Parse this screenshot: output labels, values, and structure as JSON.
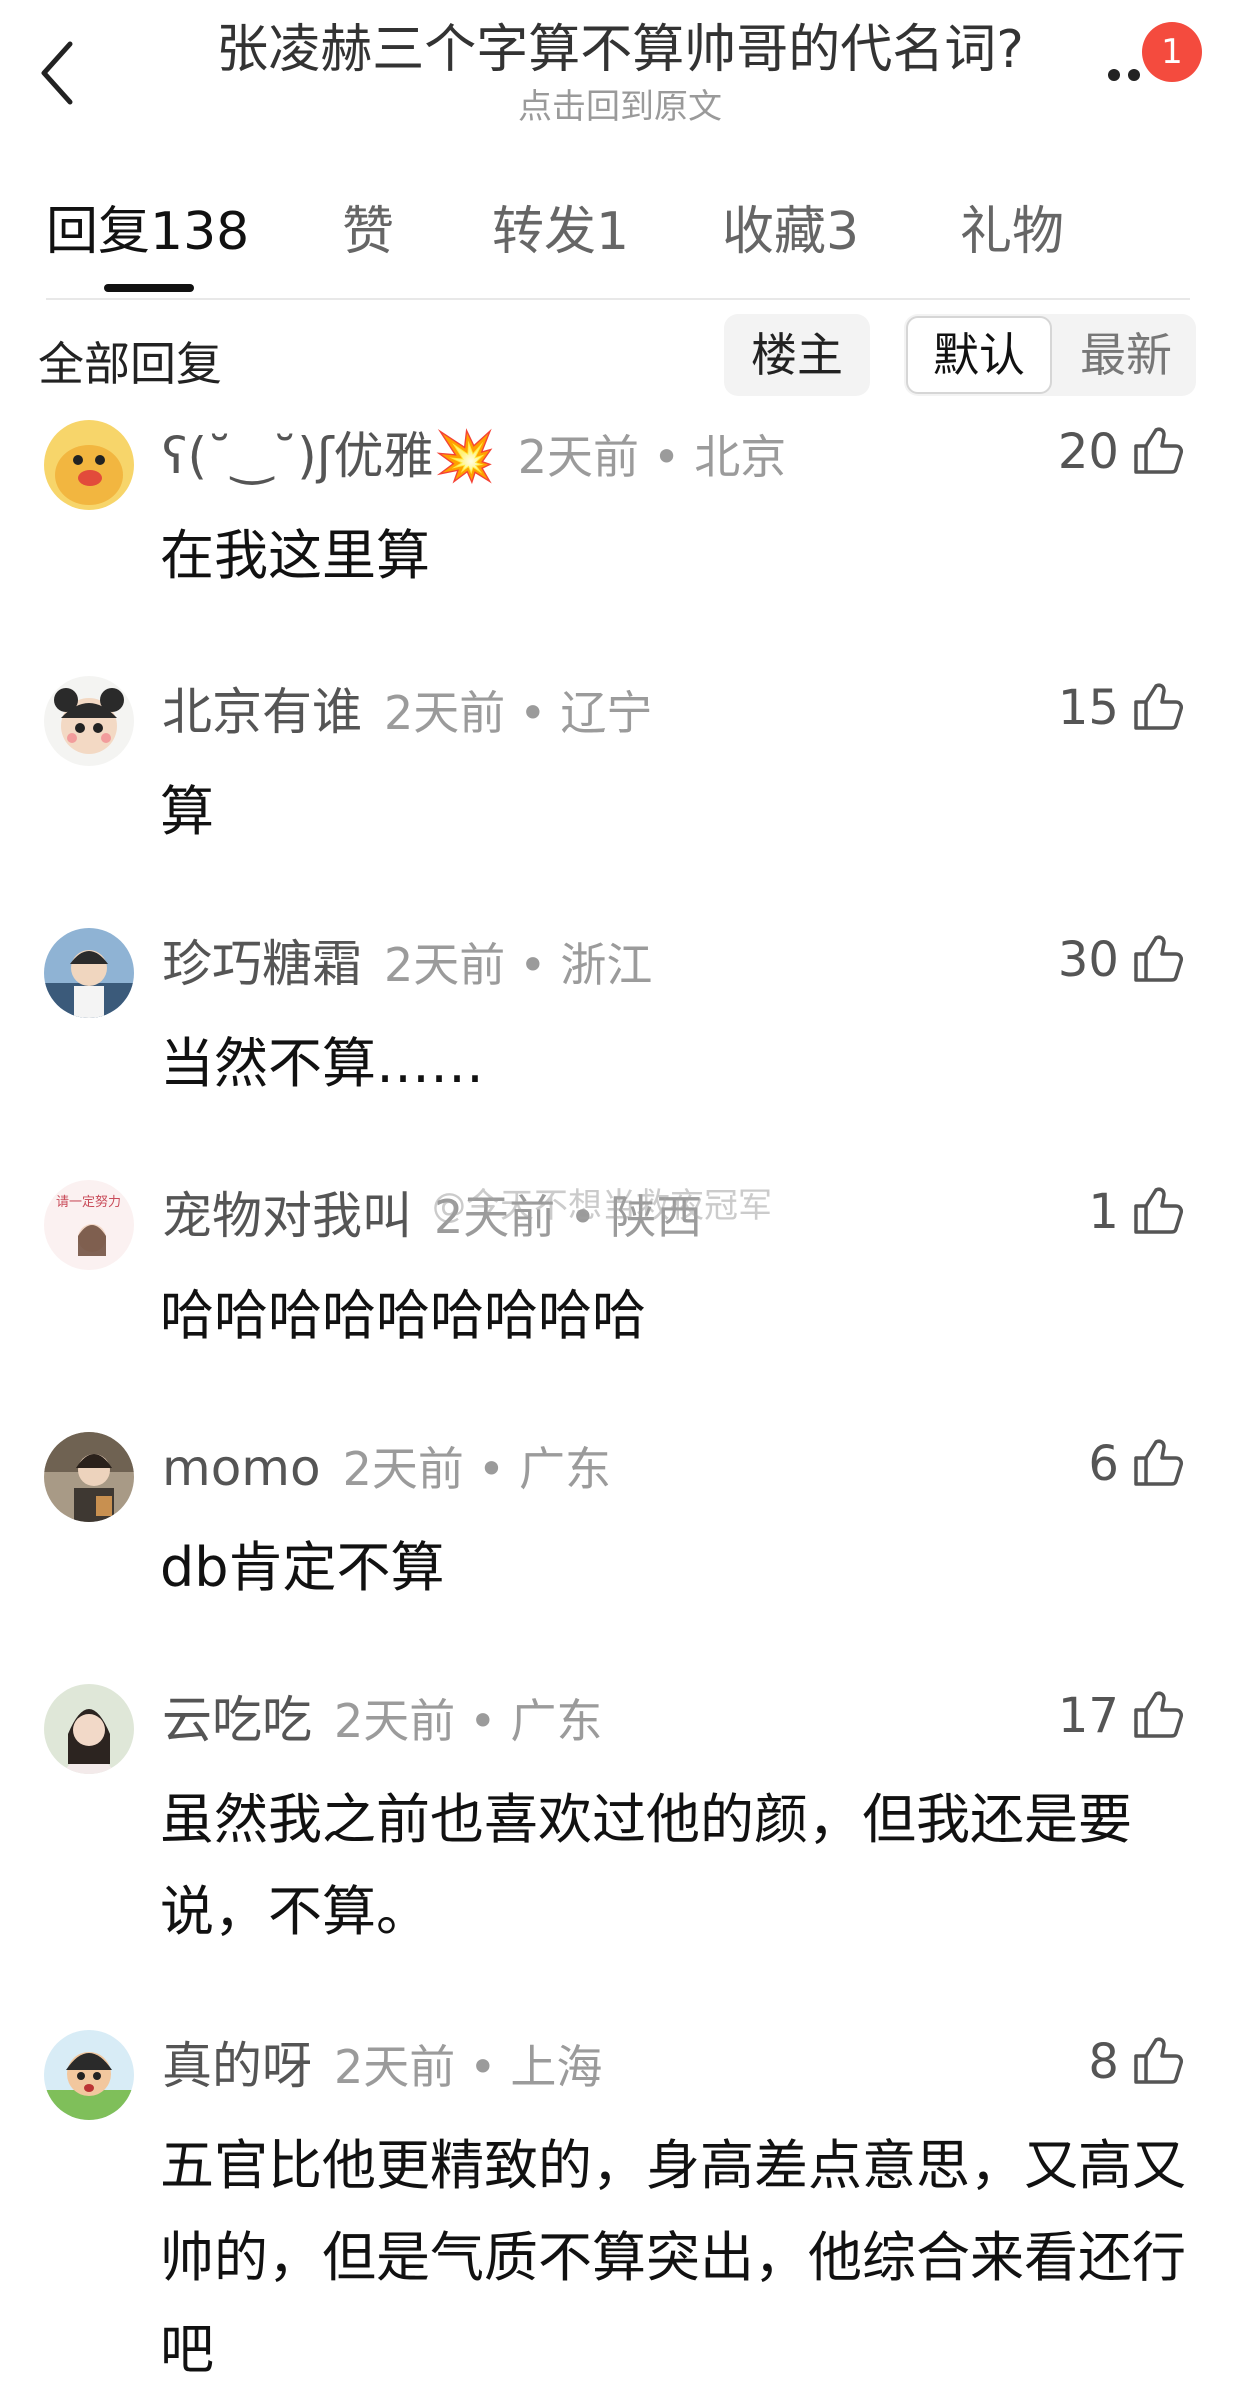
{
  "header": {
    "title": "张凌赫三个字算不算帅哥的代名词?",
    "subtitle": "点击回到原文",
    "badge_count": "1",
    "back_icon": "chevron-left-icon",
    "more_icon": "more-dots-icon"
  },
  "tabs": [
    {
      "label": "回复138",
      "active": true
    },
    {
      "label": "赞",
      "active": false
    },
    {
      "label": "转发1",
      "active": false
    },
    {
      "label": "收藏3",
      "active": false
    },
    {
      "label": "礼物",
      "active": false
    }
  ],
  "filter": {
    "label": "全部回复",
    "poster_only": "楼主",
    "sort_default": "默认",
    "sort_latest": "最新"
  },
  "watermark": "@今天不想当救夜冠军",
  "comments": [
    {
      "username": "ʕ(˘‿˘)ʃ优雅💥",
      "time": "2天前",
      "location": "北京",
      "likes": "20",
      "text": "在我这里算",
      "avatar_color": "#f2b640"
    },
    {
      "username": "北京有谁",
      "time": "2天前",
      "location": "辽宁",
      "likes": "15",
      "text": "算",
      "avatar_color": "#e9ede8"
    },
    {
      "username": "珍巧糖霜",
      "time": "2天前",
      "location": "浙江",
      "likes": "30",
      "text": "当然不算……",
      "avatar_color": "#3b5a7a"
    },
    {
      "username": "宠物对我叫",
      "time": "2天前",
      "location": "陕西",
      "likes": "1",
      "text": "哈哈哈哈哈哈哈哈哈",
      "avatar_color": "#f6e9ea"
    },
    {
      "username": "momo",
      "time": "2天前",
      "location": "广东",
      "likes": "6",
      "text": "db肯定不算",
      "avatar_color": "#8a7060"
    },
    {
      "username": "云吃吃",
      "time": "2天前",
      "location": "广东",
      "likes": "17",
      "text": "虽然我之前也喜欢过他的颜，但我还是要说，不算。",
      "avatar_color": "#c9d7c2"
    },
    {
      "username": "真的呀",
      "time": "2天前",
      "location": "上海",
      "likes": "8",
      "text": "五官比他更精致的，身高差点意思，又高又帅的，但是气质不算突出，他综合来看还行吧",
      "avatar_color": "#7fbf5a"
    }
  ]
}
